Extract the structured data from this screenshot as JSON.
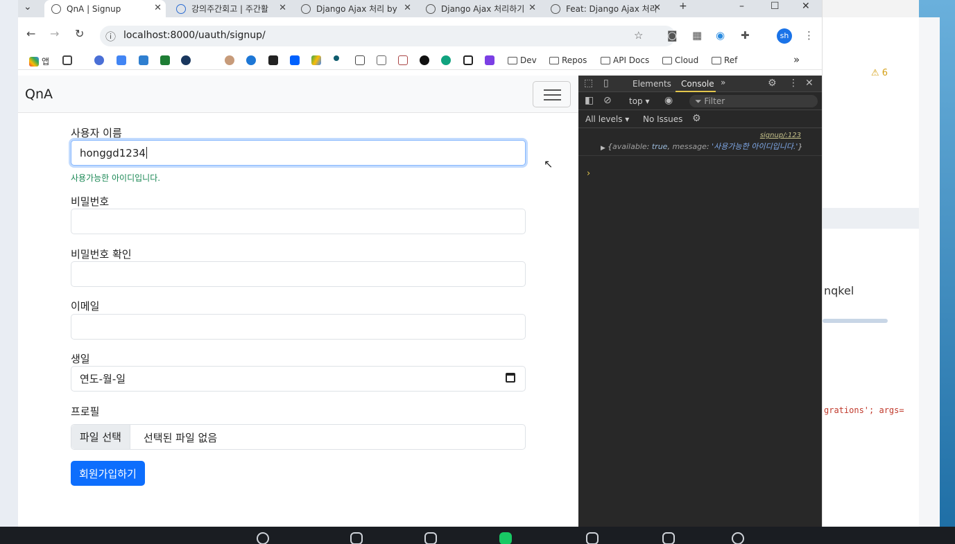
{
  "browser": {
    "tabs": [
      {
        "label": "QnA | Signup",
        "active": true
      },
      {
        "label": "강의주간회고 | 주간활",
        "active": false
      },
      {
        "label": "Django Ajax 처리 by",
        "active": false
      },
      {
        "label": "Django Ajax 처리하기",
        "active": false
      },
      {
        "label": "Feat: Django Ajax 처리",
        "active": false
      }
    ],
    "url": "localhost:8000/uauth/signup/",
    "profile_initials": "sh",
    "bookmarks": {
      "apps": "앱",
      "folders": [
        "Dev",
        "Repos",
        "API Docs",
        "Cloud",
        "Ref"
      ],
      "overflow": "»"
    }
  },
  "page": {
    "brand": "QnA",
    "form": {
      "username_label": "사용자 이름",
      "username_value": "honggd1234",
      "username_valid_msg": "사용가능한 아이디입니다.",
      "password_label": "비밀번호",
      "password_confirm_label": "비밀번호 확인",
      "email_label": "이메일",
      "birthday_label": "생일",
      "birthday_placeholder": "연도-월-일",
      "profile_label": "프로필",
      "file_button": "파일 선택",
      "file_status": "선택된 파일 없음",
      "submit_label": "회원가입하기"
    }
  },
  "devtools": {
    "tabs": [
      "Elements",
      "Console"
    ],
    "active_tab": "Console",
    "context": "top",
    "filter_placeholder": "Filter",
    "levels": "All levels",
    "issues": "No Issues",
    "log": {
      "source": "signup/:123",
      "key1": "available",
      "val1": "true",
      "key2": "message",
      "val2": "'사용가능한 아이디입니다.'"
    }
  },
  "background_app": {
    "warning_count": "6",
    "visible_text": "nqkel",
    "code_text": "grations'; args="
  }
}
